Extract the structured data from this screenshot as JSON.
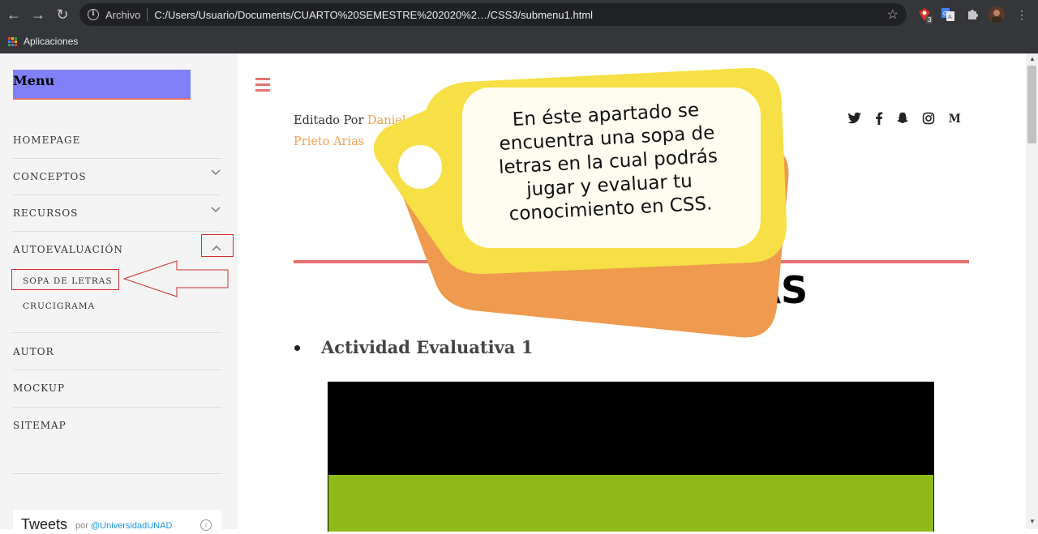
{
  "browser": {
    "address_scheme": "Archivo",
    "url": "C:/Users/Usuario/Documents/CUARTO%20SEMESTRE%202020%2…/CSS3/submenu1.html",
    "bookmark_apps": "Aplicaciones",
    "extension_badge": "3"
  },
  "sidebar": {
    "menu_title": "Menu",
    "items": [
      {
        "label": "HOMEPAGE"
      },
      {
        "label": "CONCEPTOS"
      },
      {
        "label": "RECURSOS"
      },
      {
        "label": "AUTOEVALUACIÓN"
      },
      {
        "label": "AUTOR"
      },
      {
        "label": "MOCKUP"
      },
      {
        "label": "SITEMAP"
      }
    ],
    "subitems": [
      {
        "label": "SOPA DE LETRAS"
      },
      {
        "label": "CRUCIGRAMA"
      }
    ],
    "tweets_title": "Tweets",
    "tweets_by": "por",
    "tweets_handle": "@UniversidadUNAD"
  },
  "main": {
    "edited_prefix": "Editado Por",
    "edited_author_line1": "Daniel Alejan",
    "edited_author_line2": "Prieto Arias",
    "title": "SOPA DE LETRAS",
    "activity": "Actividad Evaluativa 1",
    "socials": [
      "twitter-icon",
      "facebook-icon",
      "snapchat-icon",
      "instagram-icon",
      "medium-icon"
    ]
  },
  "tag_note": {
    "text": "En éste apartado se encuentra una sopa de letras en la cual podrás jugar y evaluar tu conocimiento en CSS."
  },
  "colors": {
    "menu_bg": "#8080f8",
    "accent_red": "#e57373",
    "author_orange": "#f0a050",
    "tag_yellow": "#f6e045",
    "tag_orange": "#ef9a4e",
    "embed_green": "#8fba18"
  }
}
